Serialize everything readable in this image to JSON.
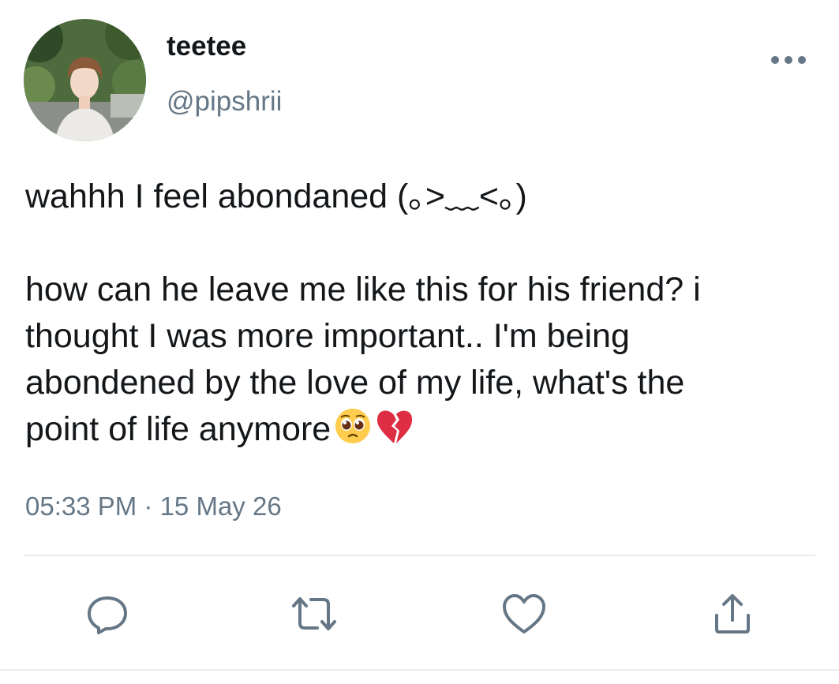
{
  "user": {
    "display_name": "teetee",
    "handle": "@pipshrii"
  },
  "tweet": {
    "paragraph_1": "wahhh I feel abondaned (｡>﹏<｡)",
    "paragraph_2_lines": [
      "how can he leave me like this for his friend? i",
      "thought I was more important.. I'm being",
      "abondened by the love of my life, what's the",
      "point of life anymore"
    ],
    "emojis": [
      "pleading-face-emoji",
      "broken-heart-emoji"
    ],
    "timestamp": "05:33 PM · 15 May 26"
  },
  "actions": {
    "icons": [
      "reply-icon",
      "retweet-icon",
      "like-icon",
      "share-icon"
    ]
  },
  "colors": {
    "text_primary": "#14171a",
    "text_secondary": "#657786",
    "icon": "#657786",
    "divider": "#e6ecf0"
  }
}
